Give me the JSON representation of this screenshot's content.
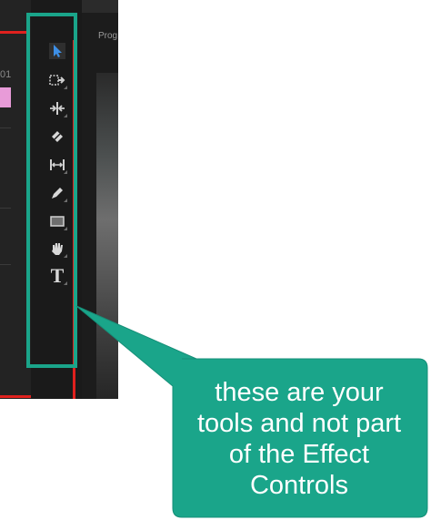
{
  "timeline": {
    "timecode_fragment": "01",
    "clip_color": "#e89bd8"
  },
  "program_monitor": {
    "label_fragment": "Prog"
  },
  "toolbar": {
    "tools": [
      {
        "name": "selection-tool",
        "icon": "arrow-icon",
        "selected": true
      },
      {
        "name": "track-select-tool",
        "icon": "track-select-icon"
      },
      {
        "name": "ripple-edit-tool",
        "icon": "ripple-edit-icon"
      },
      {
        "name": "razor-tool",
        "icon": "razor-icon"
      },
      {
        "name": "slip-tool",
        "icon": "slip-icon"
      },
      {
        "name": "pen-tool",
        "icon": "pen-icon"
      },
      {
        "name": "rectangle-tool",
        "icon": "rectangle-icon"
      },
      {
        "name": "hand-tool",
        "icon": "hand-icon"
      },
      {
        "name": "type-tool",
        "icon": "type-icon",
        "glyph": "T"
      }
    ]
  },
  "callout": {
    "text": "these are your\ntools and not part\nof the Effect\nControls",
    "color": "#1aa58a"
  }
}
